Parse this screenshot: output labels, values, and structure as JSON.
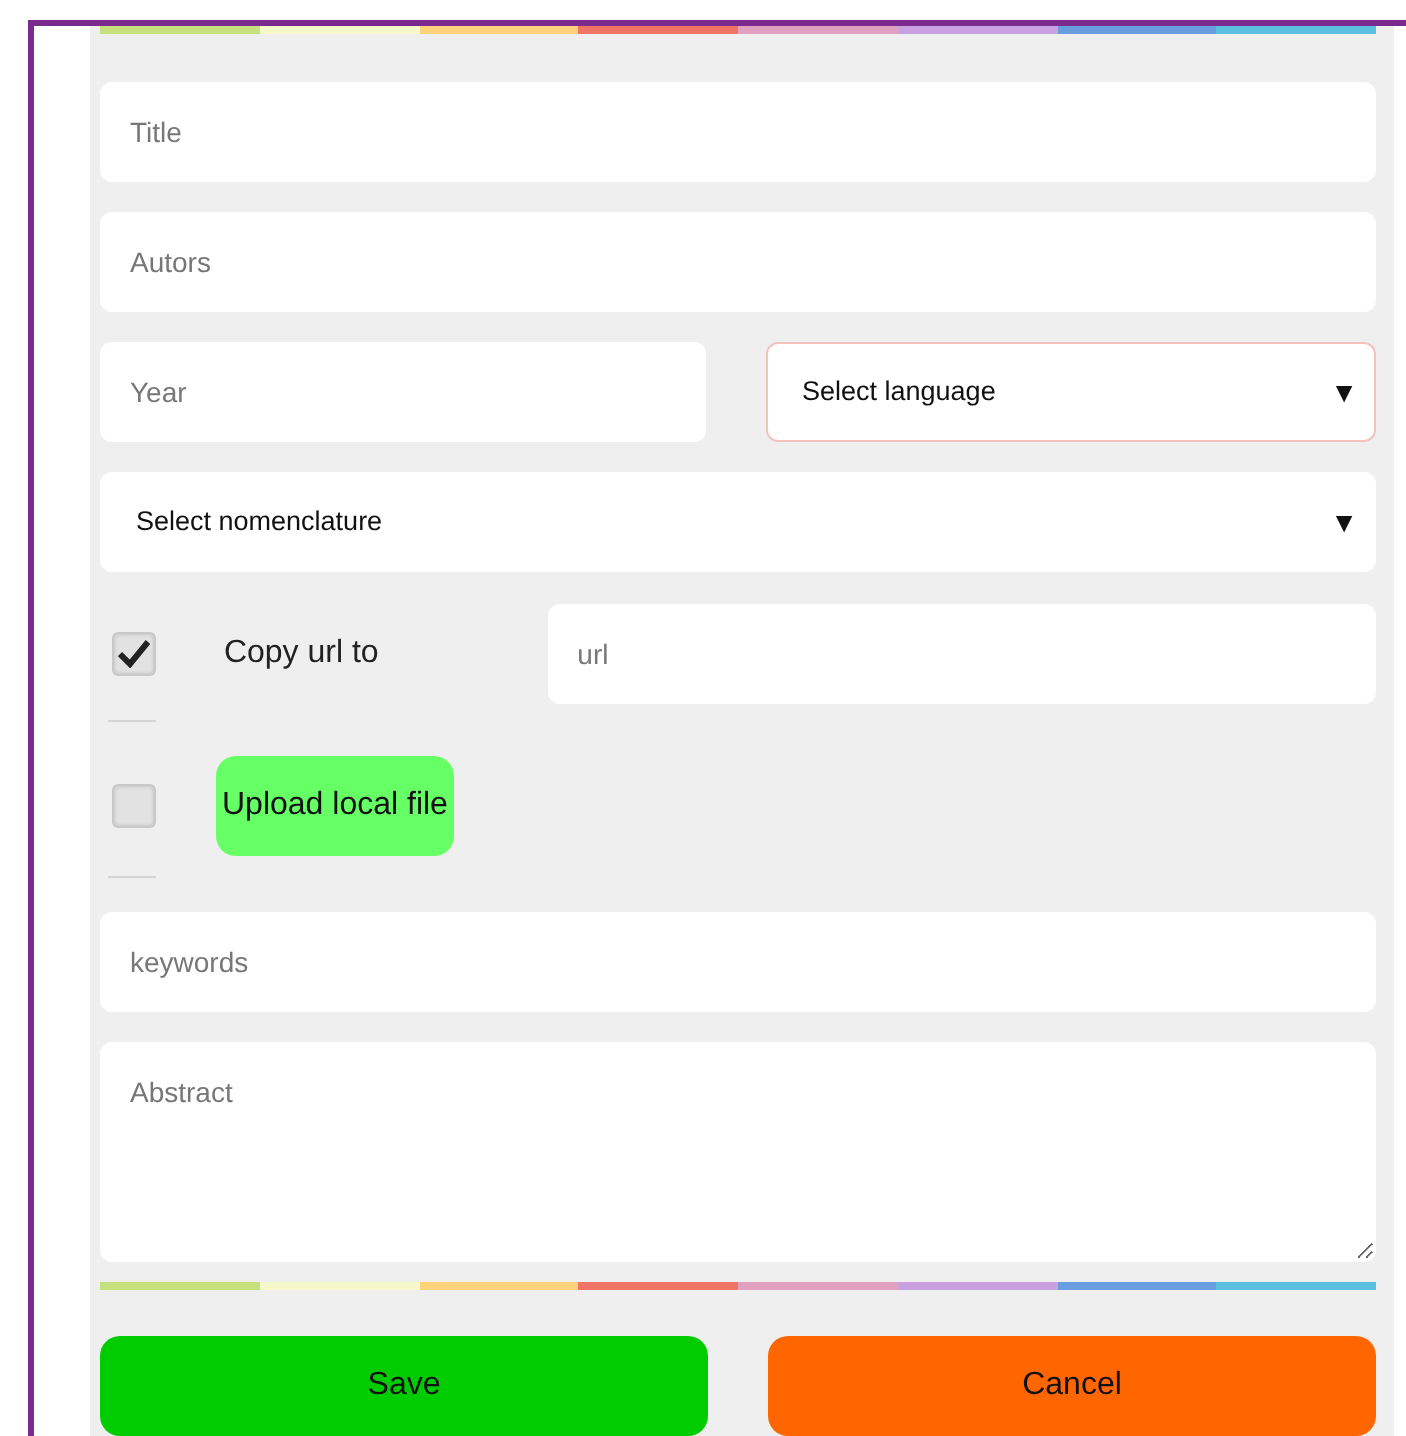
{
  "title_field": {
    "placeholder": "Title"
  },
  "authors_field": {
    "placeholder": "Autors"
  },
  "year_field": {
    "placeholder": "Year"
  },
  "language_select": {
    "label": "Select language",
    "arrow": "▼",
    "highlighted": true
  },
  "nomenclature_select": {
    "label": "Select nomenclature",
    "arrow": "▼",
    "highlighted": false
  },
  "sources": [
    {
      "kind": "url",
      "label": "Copy url to",
      "checked": true,
      "placeholder": "url"
    },
    {
      "kind": "upload",
      "label": "Upload local file",
      "checked": false
    }
  ],
  "keywords_field": {
    "placeholder": "keywords"
  },
  "abstract_field": {
    "placeholder": "Abstract"
  },
  "buttons": [
    {
      "kind": "save",
      "label": "Save"
    },
    {
      "kind": "cancel",
      "label": "Cancel"
    }
  ]
}
